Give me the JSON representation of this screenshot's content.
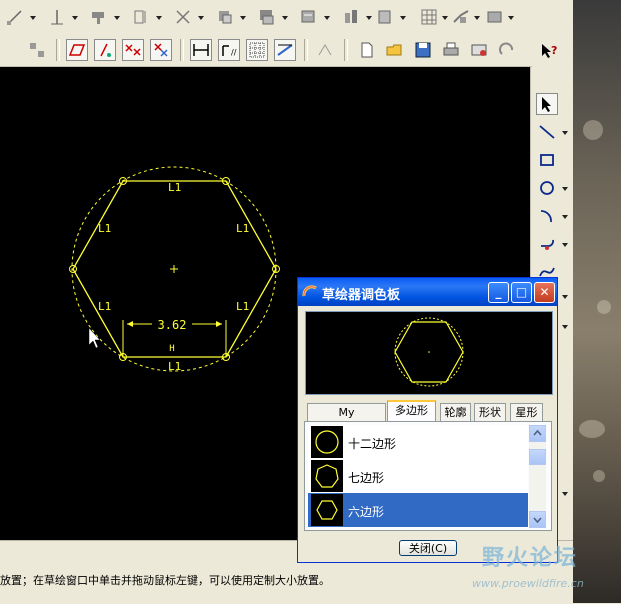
{
  "toolbar_top": {
    "groups": [
      "sketch-line",
      "dimension",
      "constraint",
      "trim",
      "mirror",
      "rotate",
      "palette-tools",
      "align",
      "offset",
      "construct",
      "ref",
      "grid"
    ]
  },
  "toolbar_second": {
    "buttons": [
      "hidden-line",
      "no-hidden",
      "shading",
      "datum-planes",
      "datum-axes",
      "datum-points",
      "datum-csys",
      "spin-center",
      "new",
      "open",
      "save",
      "print",
      "email",
      "redo",
      "whats-this"
    ]
  },
  "sketch": {
    "dim_value": "3.62",
    "dim_letter": "H",
    "length_label": "L1"
  },
  "palette": {
    "title": "草绘器调色板",
    "tabs": [
      "My Documents",
      "多边形",
      "轮廓",
      "形状",
      "星形"
    ],
    "active_tab": "多边形",
    "items": [
      "十二边形",
      "七边形",
      "六边形"
    ],
    "selected_item": "六边形",
    "close_label": "关闭(C)"
  },
  "status": {
    "text": "放置；在草绘窗口中单击并拖动鼠标左键，可以使用定制大小放置。"
  },
  "watermark": {
    "title": "野火论坛",
    "url": "www.proewildfire.cn"
  },
  "colors": {
    "sketch_yellow": "#ffff33",
    "canvas": "#000000",
    "selection": "#316ac5"
  }
}
